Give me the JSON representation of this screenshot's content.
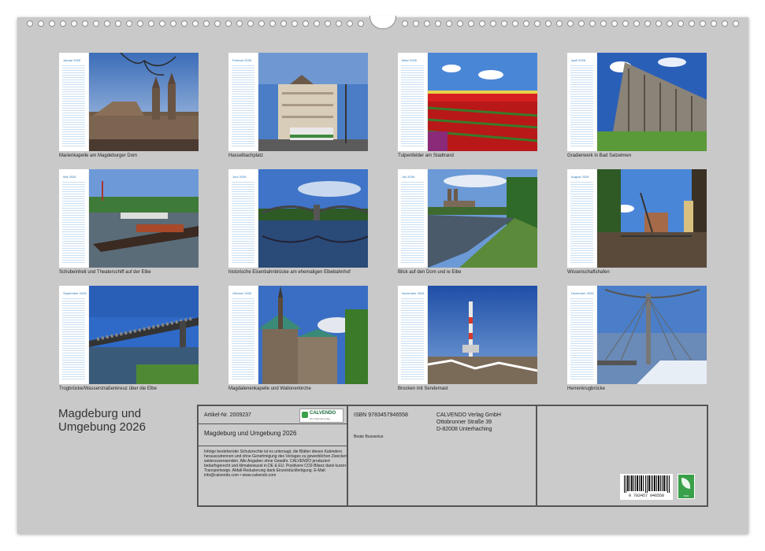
{
  "calendar": {
    "title": "Magdeburg und Umgebung 2026",
    "months": [
      {
        "name": "Januar 2026",
        "caption": "Marienkapelle am Magdeburger Dom"
      },
      {
        "name": "Februar 2026",
        "caption": "Hasselbachplatz"
      },
      {
        "name": "März 2026",
        "caption": "Tulpenfelder am Stadtrand"
      },
      {
        "name": "April 2026",
        "caption": "Gradierwerk in Bad Salzelmen"
      },
      {
        "name": "Mai 2026",
        "caption": "Schubeinheit und Theaterschiff auf der Elbe"
      },
      {
        "name": "Juni 2026",
        "caption": "historische Eisenbahnbrücke am ehemaligen Elbebahnhof"
      },
      {
        "name": "Juli 2026",
        "caption": "Blick auf den Dom und ie Elbe"
      },
      {
        "name": "August 2026",
        "caption": "Wissenschaftshafen"
      },
      {
        "name": "September 2026",
        "caption": "Trogbrücke/Wasserstraßenkreuz über die Elbe"
      },
      {
        "name": "Oktober 2026",
        "caption": "Magdalenenkapelle und Wallonerkirche"
      },
      {
        "name": "November 2026",
        "caption": "Brocken mit Sendemast"
      },
      {
        "name": "Dezember 2026",
        "caption": "Herrenkrugbrücke"
      }
    ]
  },
  "info": {
    "article_no": "Artikel-Nr. 2009237",
    "logo_text": "CALVENDO",
    "logo_subtext": "Der Kalenderverlag",
    "product_title": "Magdeburg und Umgebung 2026",
    "legal_text": "Infolge bestehender Schutzrechte ist es untersagt, die Blätter dieses Kalenders herauszutrennen und ohne Genehmigung des Verlages zu gewerblichen Zwecken weiterzuverwenden. Alle Angaben ohne Gewähr. CALVENDO produziert bedarfsgerecht und klimabewusst in DE & EU. Positivere CO2-Bilanz dank kurzer Transportwege. Abfall-Reduzierung dank Einzelstückfertigung. E-Mail: info@calvendo.com • www.calvendo.com",
    "isbn": "ISBN 9783457946558",
    "author": "Beate Bussenius",
    "publisher_name": "CALVENDO Verlag GmbH",
    "publisher_street": "Ottobrunner Straße 39",
    "publisher_city": "D-82008 Unterhaching",
    "barcode_number": "9 783457 946558",
    "eco_label": "eco"
  },
  "colors": {
    "page_background": "#c9c9c9",
    "calendar_accent": "#2b7ab8",
    "eco_green": "#3aa04a"
  }
}
